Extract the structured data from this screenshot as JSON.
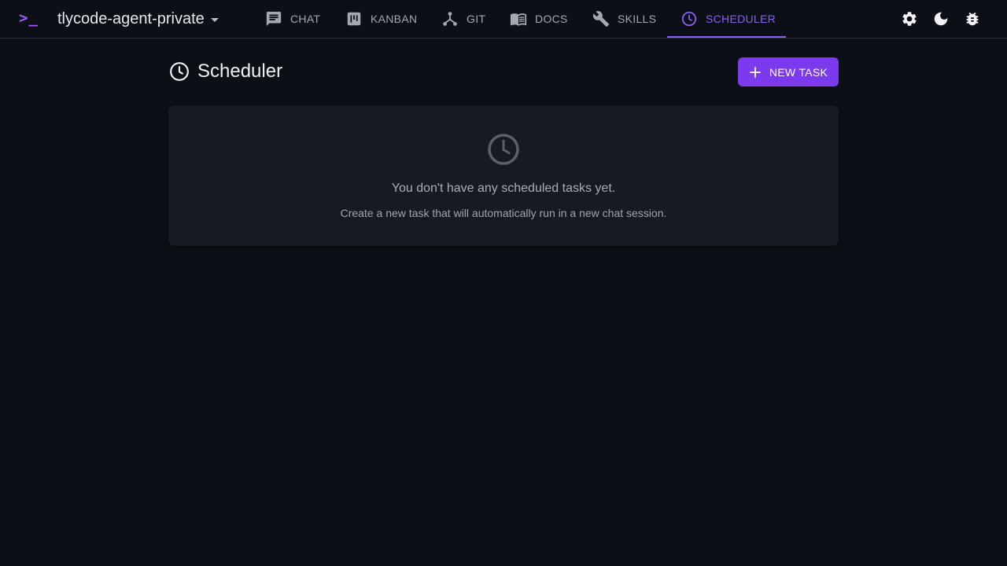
{
  "header": {
    "logo_text": ">_",
    "project_name": "tlycode-agent-private",
    "tabs": [
      {
        "label": "CHAT",
        "icon": "chat-icon",
        "active": false
      },
      {
        "label": "KANBAN",
        "icon": "kanban-icon",
        "active": false
      },
      {
        "label": "GIT",
        "icon": "git-icon",
        "active": false
      },
      {
        "label": "DOCS",
        "icon": "docs-icon",
        "active": false
      },
      {
        "label": "SKILLS",
        "icon": "wrench-icon",
        "active": false
      },
      {
        "label": "SCHEDULER",
        "icon": "clock-icon",
        "active": true
      }
    ],
    "actions": [
      "gear-icon",
      "moon-icon",
      "bug-icon"
    ]
  },
  "page": {
    "title": "Scheduler",
    "title_icon": "clock-icon",
    "new_task_label": "NEW TASK"
  },
  "empty_state": {
    "icon": "clock-icon",
    "title": "You don't have any scheduled tasks yet.",
    "subtitle": "Create a new task that will automatically run in a new chat session."
  },
  "colors": {
    "background": "#0c0f16",
    "card": "#161a22",
    "accent": "#7c3aed",
    "accent_text": "#8b5cf6",
    "border": "#2a2e38"
  }
}
